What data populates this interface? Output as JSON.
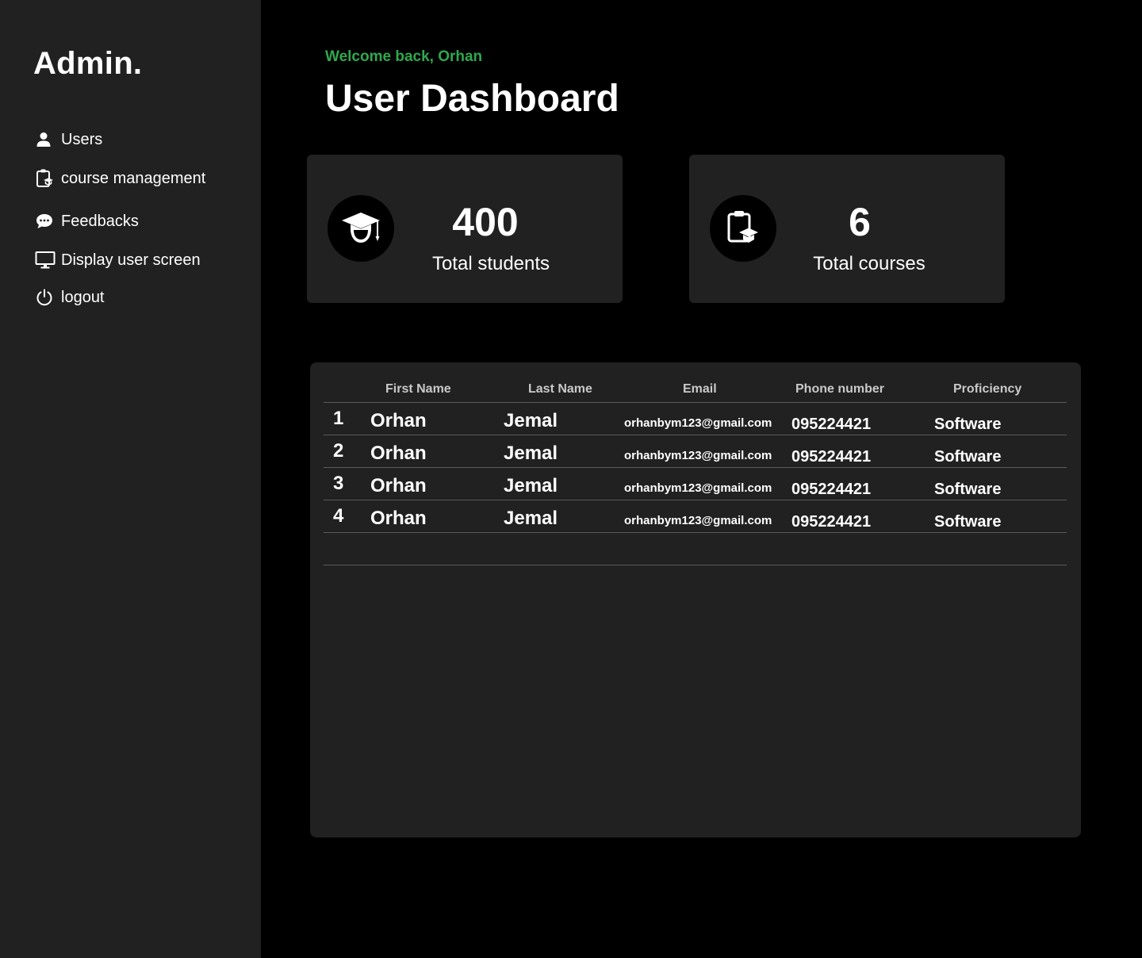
{
  "sidebar": {
    "brand": "Admin.",
    "items": [
      {
        "label": "Users",
        "icon": "user-icon"
      },
      {
        "label": "course management",
        "icon": "clipboard-icon"
      },
      {
        "label": "Feedbacks",
        "icon": "chat-bubble-icon"
      },
      {
        "label": "Display user screen",
        "icon": "monitor-icon"
      },
      {
        "label": "logout",
        "icon": "power-icon"
      }
    ]
  },
  "header": {
    "welcome": "Welcome back, Orhan",
    "title": "User Dashboard"
  },
  "stats": {
    "students": {
      "value": "400",
      "label": "Total students",
      "icon": "graduation-cap-icon"
    },
    "courses": {
      "value": "6",
      "label": "Total courses",
      "icon": "course-clipboard-icon"
    }
  },
  "table": {
    "columns": [
      "First Name",
      "Last Name",
      "Email",
      "Phone number",
      "Proficiency"
    ],
    "rows": [
      {
        "index": "1",
        "first": "Orhan",
        "last": "Jemal",
        "email": "orhanbym123@gmail.com",
        "phone": "095224421",
        "proficiency": "Software"
      },
      {
        "index": "2",
        "first": "Orhan",
        "last": "Jemal",
        "email": "orhanbym123@gmail.com",
        "phone": "095224421",
        "proficiency": "Software"
      },
      {
        "index": "3",
        "first": "Orhan",
        "last": "Jemal",
        "email": "orhanbym123@gmail.com",
        "phone": "095224421",
        "proficiency": "Software"
      },
      {
        "index": "4",
        "first": "Orhan",
        "last": "Jemal",
        "email": "orhanbym123@gmail.com",
        "phone": "095224421",
        "proficiency": "Software"
      }
    ]
  },
  "colors": {
    "background": "#000000",
    "panel": "#212121",
    "accent": "#2fa84f",
    "text": "#ffffff"
  }
}
